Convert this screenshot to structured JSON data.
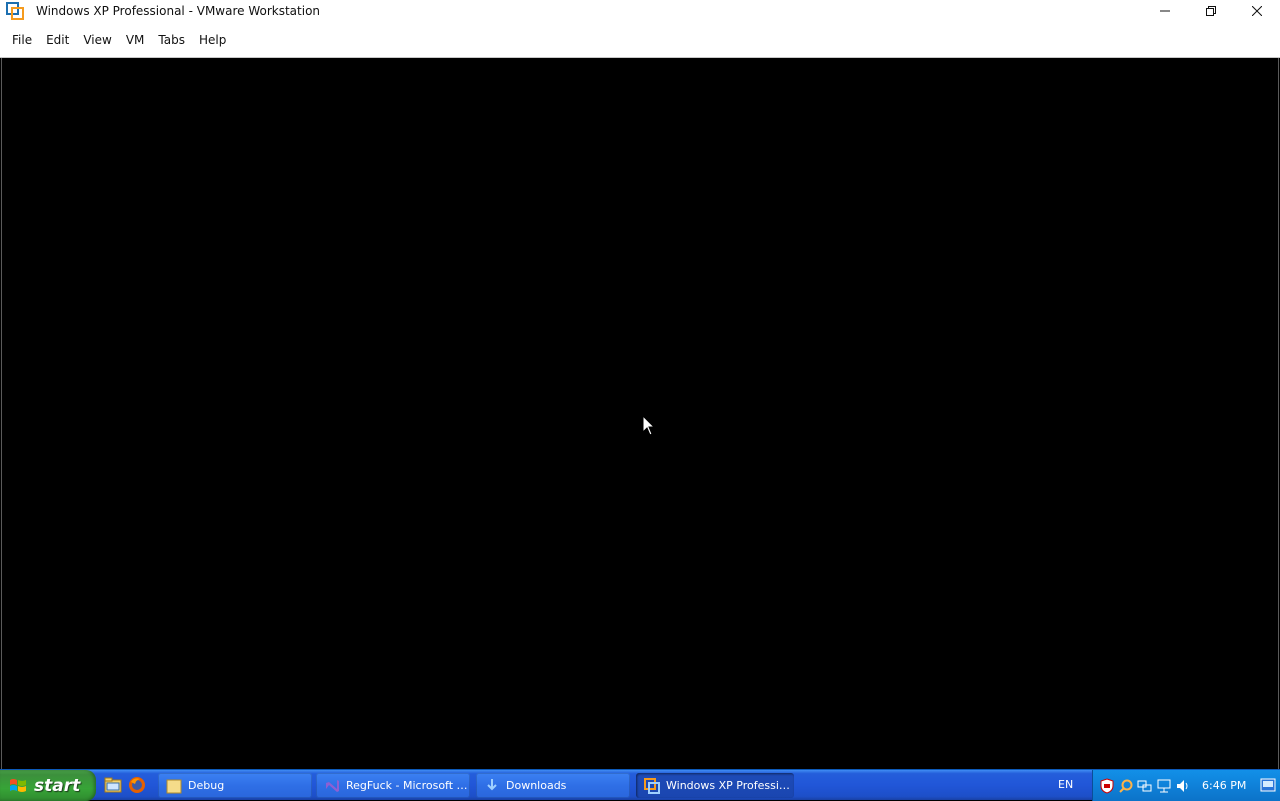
{
  "window": {
    "title": "Windows XP Professional - VMware Workstation",
    "icon": "vmware-icon",
    "controls": [
      "minimize-icon",
      "restore-icon",
      "close-icon"
    ]
  },
  "menu": {
    "items": [
      "File",
      "Edit",
      "View",
      "VM",
      "Tabs",
      "Help"
    ]
  },
  "taskbar": {
    "start_label": "start",
    "quick_launch": [
      "explorer-icon",
      "firefox-icon"
    ],
    "tasks": [
      {
        "label": "Debug",
        "icon": "folder-icon",
        "active": false
      },
      {
        "label": "RegFuck - Microsoft Vi...",
        "icon": "visual-studio-icon",
        "active": false
      },
      {
        "label": "Downloads",
        "icon": "downloads-icon",
        "active": false
      },
      {
        "label": "Windows XP Professio...",
        "icon": "vmware-icon",
        "active": true
      }
    ],
    "language": "EN",
    "clock": "6:46 PM",
    "tray_icons": [
      "security-icon",
      "search-icon",
      "network-icon",
      "network-icon",
      "volume-icon"
    ]
  },
  "colors": {
    "taskbar_blue": "#245edb",
    "start_green": "#3c8f3c",
    "tray_blue": "#0f81d9",
    "vm_background": "#000000"
  }
}
